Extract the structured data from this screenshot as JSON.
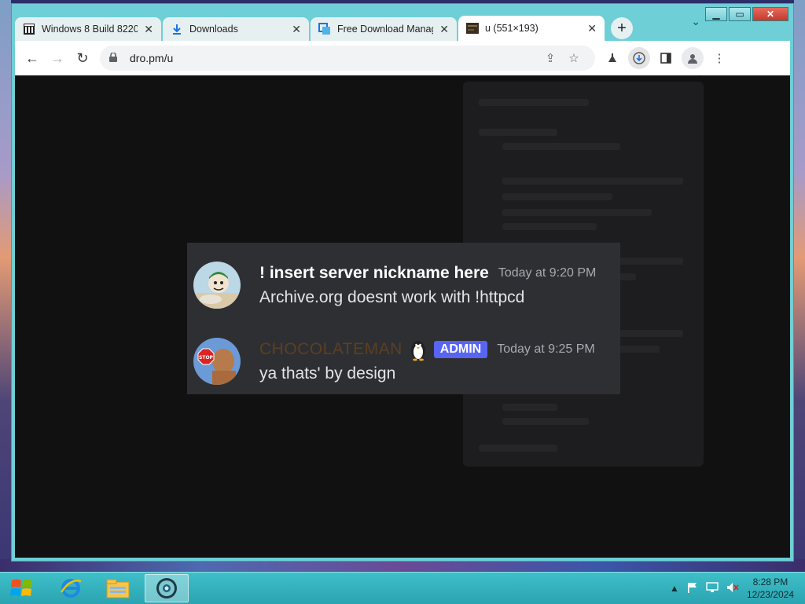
{
  "browser": {
    "tabs": [
      {
        "title": "Windows 8 Build 8220",
        "icon": "archive-icon",
        "active": false
      },
      {
        "title": "Downloads",
        "icon": "download-icon",
        "active": false
      },
      {
        "title": "Free Download Manag",
        "icon": "fdm-icon",
        "active": false
      },
      {
        "title": "u (551×193)",
        "icon": "image-thumb-icon",
        "active": true
      }
    ],
    "new_tab_label": "+",
    "url": "dro.pm/u"
  },
  "window_controls": {
    "minimize": "▁",
    "maximize": "▭",
    "close": "✕"
  },
  "messages": [
    {
      "author": "! insert server nickname here",
      "timestamp": "Today at 9:20 PM",
      "text": "Archive.org doesnt work with !httpcd",
      "avatar": "cartoon-avatar"
    },
    {
      "author": "CHOCOLATEMAN",
      "badge": "ADMIN",
      "timestamp": "Today at 9:25 PM",
      "text": "ya thats' by design",
      "avatar": "stop-sign-avatar",
      "author_color": "#5c3f22"
    }
  ],
  "taskbar": {
    "clock_time": "8:28 PM",
    "clock_date": "12/23/2024"
  },
  "colors": {
    "accent_admin": "#5865f2",
    "frame": "#6ecfd6",
    "content_bg": "#111112"
  }
}
